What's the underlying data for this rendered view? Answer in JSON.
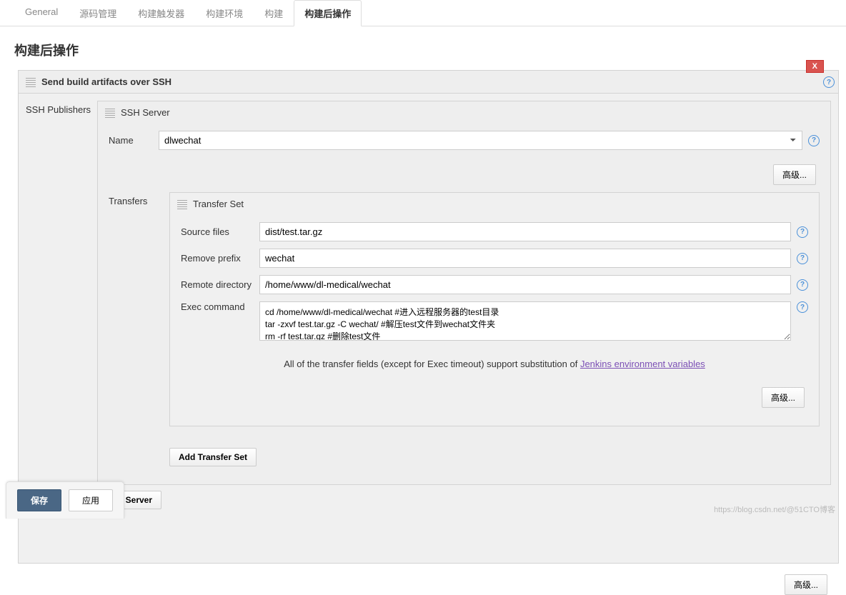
{
  "tabs": {
    "general": "General",
    "scm": "源码管理",
    "triggers": "构建触发器",
    "env": "构建环境",
    "build": "构建",
    "postbuild": "构建后操作"
  },
  "section_title": "构建后操作",
  "block": {
    "title": "Send build artifacts over SSH",
    "close": "X",
    "ssh_publishers_label": "SSH Publishers",
    "ssh_server_header": "SSH Server",
    "name_label": "Name",
    "name_value": "dlwechat",
    "advanced_btn": "高级...",
    "transfers_label": "Transfers",
    "transfer_set_header": "Transfer Set",
    "fields": {
      "source_files_label": "Source files",
      "source_files_value": "dist/test.tar.gz",
      "remove_prefix_label": "Remove prefix",
      "remove_prefix_value": "wechat",
      "remote_directory_label": "Remote directory",
      "remote_directory_value": "/home/www/dl-medical/wechat",
      "exec_command_label": "Exec command",
      "exec_command_value": "cd /home/www/dl-medical/wechat #进入远程服务器的test目录\ntar -zxvf test.tar.gz -C wechat/ #解压test文件到wechat文件夹\nrm -rf test.tar.gz #删除test文件"
    },
    "note_prefix": "All of the transfer fields (except for Exec timeout) support substitution of ",
    "note_link": "Jenkins environment variables",
    "add_transfer_set": "Add Transfer Set",
    "add_server": "Add Server"
  },
  "footer": {
    "save": "保存",
    "apply": "应用"
  },
  "watermark": "https://blog.csdn.net/@51CTO博客"
}
